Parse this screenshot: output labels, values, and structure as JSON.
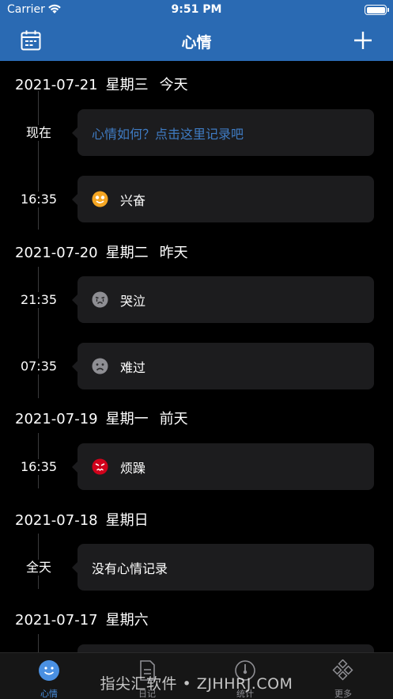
{
  "status": {
    "carrier": "Carrier",
    "time": "9:51 PM"
  },
  "nav": {
    "title": "心情",
    "left_icon": "calendar-icon",
    "right_icon": "plus-icon"
  },
  "days": [
    {
      "date": "2021-07-21",
      "weekday": "星期三",
      "relative": "今天",
      "entries": [
        {
          "time": "现在",
          "text": "心情如何？点击这里记录吧",
          "mood": "prompt"
        },
        {
          "time": "16:35",
          "text": "兴奋",
          "mood": "excited",
          "color": "#f5a623"
        }
      ]
    },
    {
      "date": "2021-07-20",
      "weekday": "星期二",
      "relative": "昨天",
      "entries": [
        {
          "time": "21:35",
          "text": "哭泣",
          "mood": "crying",
          "color": "#8e8e93"
        },
        {
          "time": "07:35",
          "text": "难过",
          "mood": "sad",
          "color": "#8e8e93"
        }
      ]
    },
    {
      "date": "2021-07-19",
      "weekday": "星期一",
      "relative": "前天",
      "entries": [
        {
          "time": "16:35",
          "text": "烦躁",
          "mood": "irritated",
          "color": "#d0021b"
        }
      ]
    },
    {
      "date": "2021-07-18",
      "weekday": "星期日",
      "relative": "",
      "entries": [
        {
          "time": "全天",
          "text": "没有心情记录",
          "mood": "none"
        }
      ]
    },
    {
      "date": "2021-07-17",
      "weekday": "星期六",
      "relative": "",
      "entries": [
        {
          "time": "",
          "text": "",
          "mood": "none"
        }
      ]
    }
  ],
  "tabs": [
    {
      "label": "心情",
      "icon": "smile-icon",
      "active": true
    },
    {
      "label": "日记",
      "icon": "diary-icon",
      "active": false
    },
    {
      "label": "统计",
      "icon": "gauge-icon",
      "active": false
    },
    {
      "label": "更多",
      "icon": "grid-icon",
      "active": false
    }
  ],
  "watermark": "指尖汇软件 • ZJHHRJ.COM",
  "colors": {
    "nav": "#2a6ab3",
    "accent": "#3f7cc4",
    "card": "#1c1c1e"
  }
}
